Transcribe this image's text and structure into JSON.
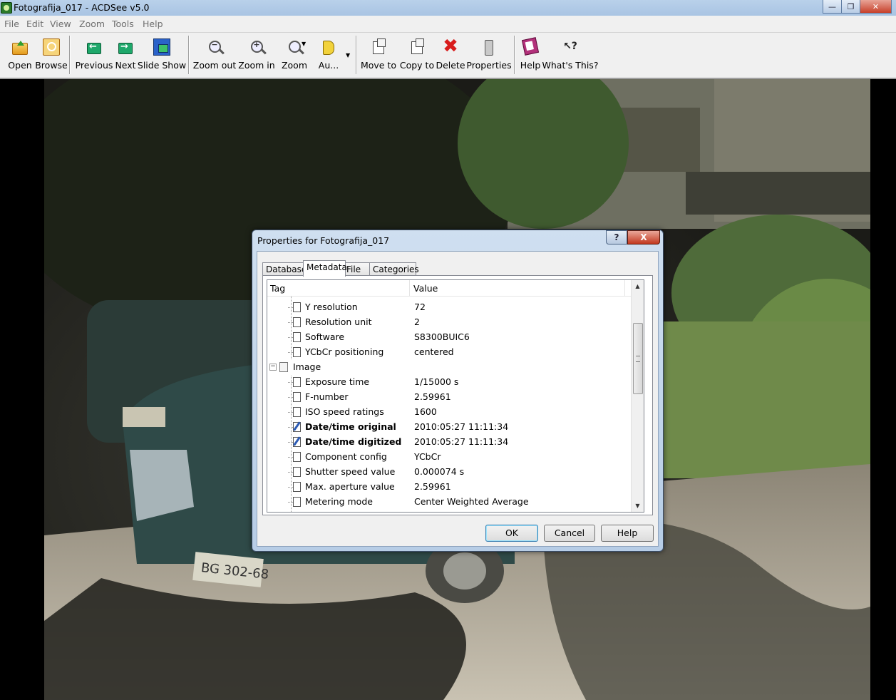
{
  "window": {
    "title": "Fotografija_017 - ACDSee v5.0"
  },
  "menu": [
    "File",
    "Edit",
    "View",
    "Zoom",
    "Tools",
    "Help"
  ],
  "toolbar": {
    "open": "Open",
    "browse": "Browse",
    "previous": "Previous",
    "next": "Next",
    "slideshow": "Slide Show",
    "zoom_out": "Zoom out",
    "zoom_in": "Zoom in",
    "zoom": "Zoom",
    "audio": "Au...",
    "move_to": "Move to",
    "copy_to": "Copy to",
    "delete": "Delete",
    "properties": "Properties",
    "help": "Help",
    "whats_this": "What's This?"
  },
  "dialog": {
    "title": "Properties for Fotografija_017",
    "help_glyph": "?",
    "close_glyph": "X",
    "tabs": [
      "Database",
      "Metadata",
      "File",
      "Categories"
    ],
    "active_tab": "Metadata",
    "columns": {
      "tag": "Tag",
      "value": "Value"
    },
    "rows": [
      {
        "tag": "Y resolution",
        "value": "72"
      },
      {
        "tag": "Resolution unit",
        "value": "2"
      },
      {
        "tag": "Software",
        "value": "S8300BUIC6"
      },
      {
        "tag": "YCbCr positioning",
        "value": "centered"
      },
      {
        "group": "Image"
      },
      {
        "tag": "Exposure time",
        "value": "1/15000 s"
      },
      {
        "tag": "F-number",
        "value": "2.59961"
      },
      {
        "tag": "ISO speed ratings",
        "value": "1600"
      },
      {
        "tag": "Date/time original",
        "value": "2010:05:27 11:11:34",
        "bold": true
      },
      {
        "tag": "Date/time digitized",
        "value": "2010:05:27 11:11:34",
        "bold": true
      },
      {
        "tag": "Component config",
        "value": "YCbCr"
      },
      {
        "tag": "Shutter speed value",
        "value": "0.000074 s"
      },
      {
        "tag": "Max. aperture value",
        "value": "2.59961"
      },
      {
        "tag": "Metering mode",
        "value": "Center Weighted Average"
      }
    ],
    "buttons": {
      "ok": "OK",
      "cancel": "Cancel",
      "help": "Help"
    }
  },
  "colors": {
    "titlebar": "#b9d1ea",
    "dialog_frame": "#b7cde6",
    "delete_icon": "#d81c1c"
  },
  "icons": [
    "open-icon",
    "browse-icon",
    "previous-icon",
    "next-icon",
    "slideshow-icon",
    "zoom-out-icon",
    "zoom-in-icon",
    "zoom-icon",
    "audio-icon",
    "move-to-icon",
    "copy-to-icon",
    "delete-icon",
    "properties-icon",
    "help-icon",
    "whats-this-icon"
  ]
}
